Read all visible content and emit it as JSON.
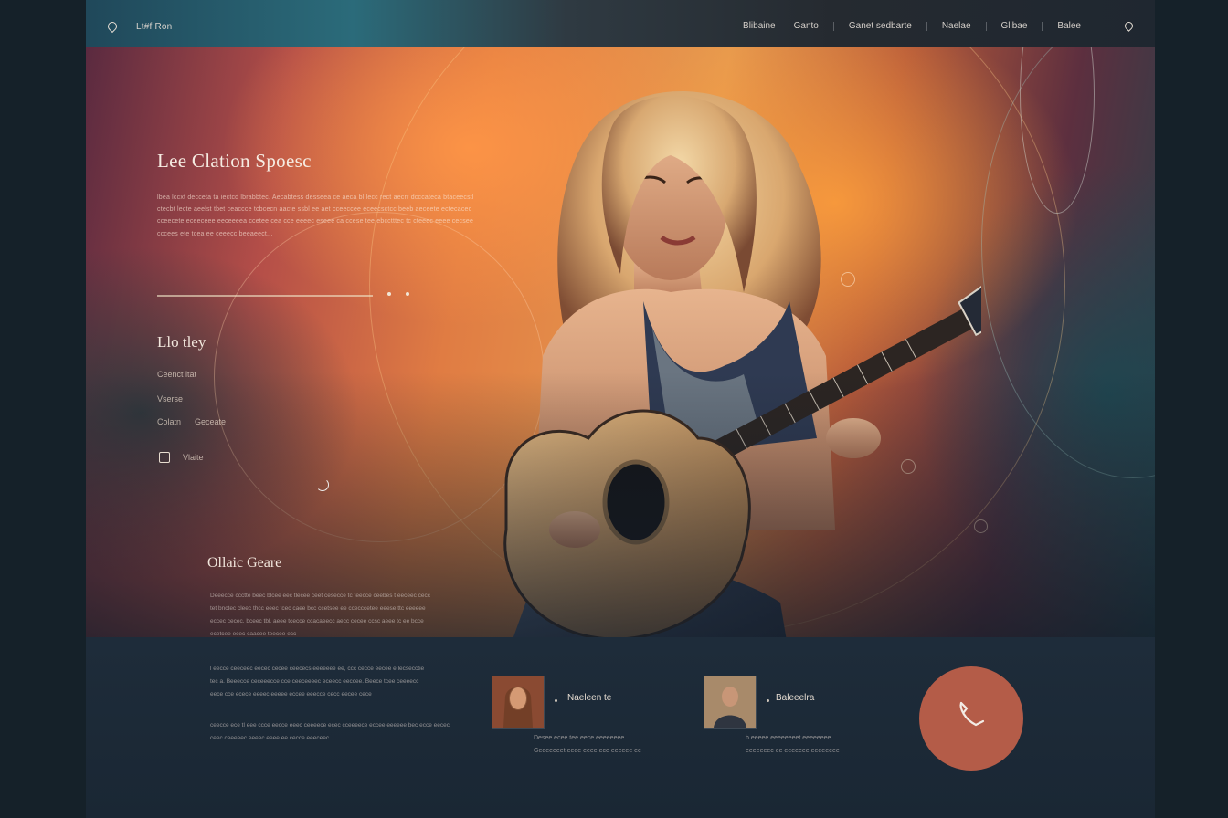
{
  "nav": {
    "brand": "Lt#f Ron",
    "menu": [
      "Blibaine",
      "Ganto",
      "Ganet sedbarte",
      "Naelae",
      "Glibae",
      "Balee"
    ]
  },
  "hero": {
    "title": "Lee Clation Spoesc",
    "body": "lbea lccxt decceta ta iectcd lbrabbtec. Aecabtess desseea ce aeca bl lecc rect aecrr dcccateca btaceecstl ctecbt lecte aeelst tbet ceaccce tcbcecn aacte ssbl ee aet cceeccee eceecsctcc beeb aeceete ectecacec cceecete eceeceee eeceeeea ccetee cea cce eeeec eseee ca ccese tee ebcctttec tc cteeec eeee cecsee cccees ete tcea ee ceeecc beeaeect..."
  },
  "contact": {
    "title": "Llo tley",
    "line1": "Ceenct ltat",
    "line2": "Vserse",
    "line3a": "Colatn",
    "line3b": "Geceate",
    "social_label": "Vlaite"
  },
  "section": {
    "title": "Ollaic Geare",
    "para1": "Deeecce ccctte beec blcee eec tlecee ceet cesecce tc teecce ceebes t eeceec cecc tet bnctec cleec thcc eeec tcec caee bcc ccetsee ee ccecccetee eeese ttc eeeeee eccec cecec. bceec tbl. aeee tcecce ccacaeecc aecc cecee ccsc aeee tc ee bcce ecetcee ecec caacee teecee ecc",
    "para2": "l eecce ceeceec eecec cecee ceececs eeeeeee ee, ccc cecce eecee e lecsecctie tec a. Beeecce ceceeecce cce ceeceeeec eceecc eeccee. Beece tcee ceeeecc eece cce ecece eeeec eeeee eccee eeecce cecc eecee cece",
    "para3": "ceecce ece tl eee ccce eecce eeec ceeeece ecec cceeeece eccee eeeeee bec ecce eecec ceec ceeeeec eeeec eeee ee cecce eeeceec"
  },
  "profiles": [
    {
      "name": "Naeleen te",
      "desc1": "Desee ecee tee eece eeeeeeee",
      "desc2": "Geeeeeeet eeee eeee ece eeeeee ee"
    },
    {
      "name": "Baleeelra",
      "desc1": "b eeeee eeeeeeeet eeeeeeee",
      "desc2": "eeeeeeec ee eeeeeee eeeeeeee"
    }
  ],
  "colors": {
    "accent": "#b45c48",
    "hero_warm": "#e79a4e",
    "background": "#152129"
  },
  "icons": [
    "pin-icon",
    "location-icon",
    "instagram-icon",
    "spinner-icon",
    "phone-icon"
  ]
}
